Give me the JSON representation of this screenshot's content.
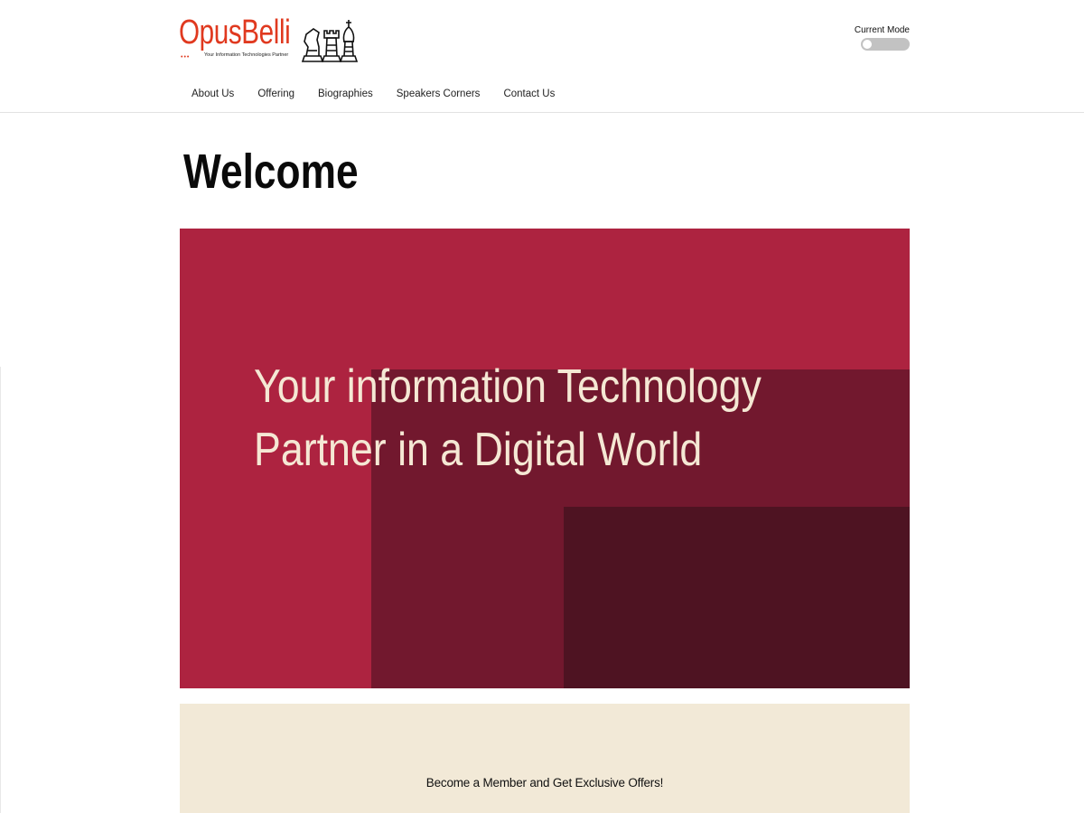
{
  "brand": {
    "name": "OpusBelli",
    "tagline": "Your Information Technologies Partner",
    "color": "#e0391f"
  },
  "mode_toggle": {
    "label": "Current Mode",
    "state": "off"
  },
  "nav": {
    "items": [
      {
        "label": "About Us"
      },
      {
        "label": "Offering"
      },
      {
        "label": "Biographies"
      },
      {
        "label": "Speakers Corners"
      },
      {
        "label": "Contact Us"
      }
    ]
  },
  "main": {
    "heading": "Welcome",
    "hero": {
      "line1": "Your information Technology",
      "line2": "Partner in a Digital World",
      "colors": {
        "primary": "#ad2340",
        "secondary": "#72182e",
        "tertiary": "#4e1322",
        "text": "#f5e8d4"
      }
    },
    "member_banner": {
      "text": "Become a Member and Get Exclusive Offers!",
      "background": "#f2e9d7"
    }
  }
}
